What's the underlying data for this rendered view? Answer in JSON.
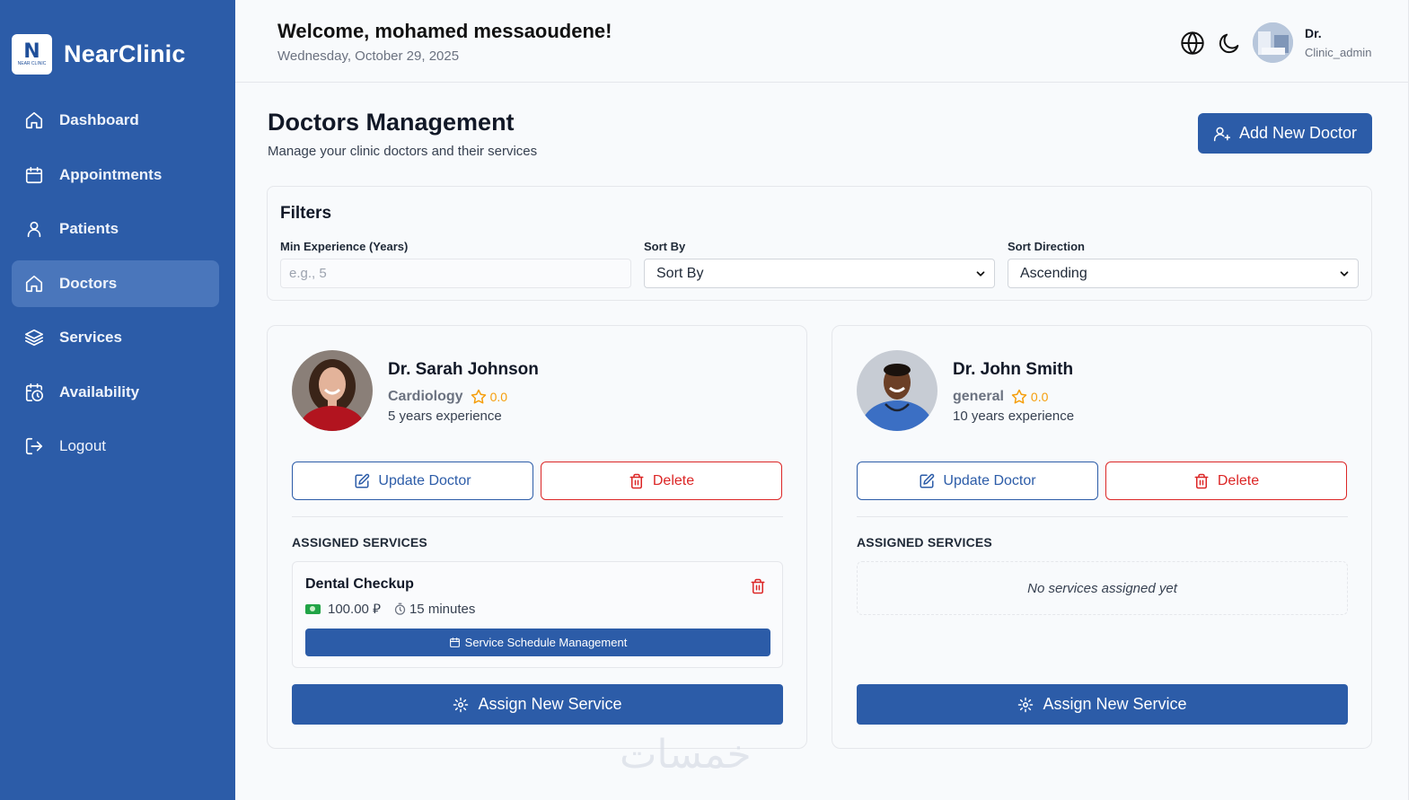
{
  "sidebar": {
    "brand": "NearClinic",
    "logo_letter": "N",
    "logo_small": "NEAR CLINIC",
    "items": [
      {
        "label": "Dashboard",
        "icon": "home-icon"
      },
      {
        "label": "Appointments",
        "icon": "calendar-icon"
      },
      {
        "label": "Patients",
        "icon": "user-icon"
      },
      {
        "label": "Doctors",
        "icon": "home-icon",
        "active": true
      },
      {
        "label": "Services",
        "icon": "layers-icon"
      },
      {
        "label": "Availability",
        "icon": "calendar-clock-icon"
      },
      {
        "label": "Logout",
        "icon": "logout-icon"
      }
    ]
  },
  "header": {
    "welcome": "Welcome, mohamed messaoudene!",
    "date": "Wednesday, October 29, 2025",
    "user_name": "Dr.",
    "user_role": "Clinic_admin",
    "icons": [
      "globe-icon",
      "moon-icon"
    ]
  },
  "main": {
    "title": "Doctors Management",
    "subtitle": "Manage your clinic doctors and their services",
    "add_button": "Add New Doctor"
  },
  "filters": {
    "title": "Filters",
    "min_exp_label": "Min Experience (Years)",
    "min_exp_placeholder": "e.g., 5",
    "sort_by_label": "Sort By",
    "sort_by_value": "Sort By",
    "sort_dir_label": "Sort Direction",
    "sort_dir_value": "Ascending"
  },
  "doctors": [
    {
      "name": "Dr. Sarah Johnson",
      "specialty": "Cardiology",
      "rating": "0.0",
      "experience": "5 years experience",
      "update_label": "Update Doctor",
      "delete_label": "Delete",
      "assigned_title": "ASSIGNED SERVICES",
      "services": [
        {
          "name": "Dental Checkup",
          "price": "100.00 ⃁",
          "duration": "15 minutes",
          "schedule_label": "Service Schedule Management"
        }
      ],
      "assign_label": "Assign New Service"
    },
    {
      "name": "Dr. John Smith",
      "specialty": "general",
      "rating": "0.0",
      "experience": "10 years experience",
      "update_label": "Update Doctor",
      "delete_label": "Delete",
      "assigned_title": "ASSIGNED SERVICES",
      "empty_text": "No services assigned yet",
      "assign_label": "Assign New Service"
    }
  ],
  "watermark": "خمسات",
  "colors": {
    "primary": "#2c5ca8",
    "sidebar_active": "#4a76bb",
    "danger": "#dc2626",
    "rating": "#f59e0b"
  }
}
